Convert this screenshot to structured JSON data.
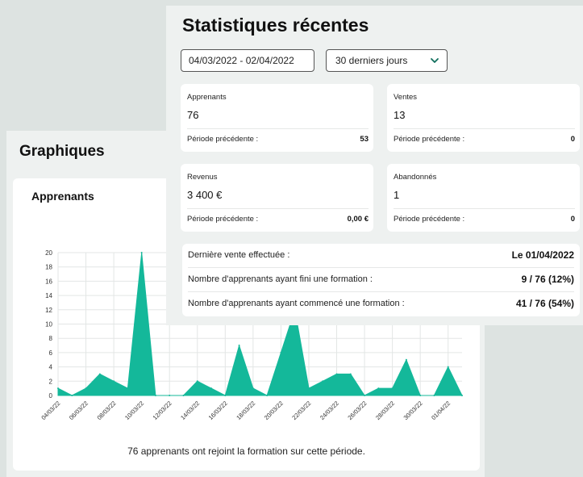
{
  "graph_panel": {
    "title": "Graphiques",
    "card_title": "Apprenants",
    "caption": "76 apprenants ont rejoint la formation sur cette période."
  },
  "chart_data": {
    "type": "area",
    "title": "",
    "xlabel": "",
    "ylabel": "",
    "ylim": [
      0,
      20
    ],
    "yticks": [
      0,
      2,
      4,
      6,
      8,
      10,
      12,
      14,
      16,
      18,
      20
    ],
    "grid": true,
    "color": "#14b89a",
    "x": [
      "04/03/22",
      "05/03/22",
      "06/03/22",
      "07/03/22",
      "08/03/22",
      "09/03/22",
      "10/03/22",
      "11/03/22",
      "12/03/22",
      "13/03/22",
      "14/03/22",
      "15/03/22",
      "16/03/22",
      "17/03/22",
      "18/03/22",
      "19/03/22",
      "20/03/22",
      "21/03/22",
      "22/03/22",
      "23/03/22",
      "24/03/22",
      "25/03/22",
      "26/03/22",
      "27/03/22",
      "28/03/22",
      "29/03/22",
      "30/03/22",
      "31/03/22",
      "01/04/22",
      "02/04/22"
    ],
    "xtick_labels": [
      "04/03/22",
      "06/03/22",
      "08/03/22",
      "10/03/22",
      "12/03/22",
      "14/03/22",
      "16/03/22",
      "18/03/22",
      "20/03/22",
      "22/03/22",
      "24/03/22",
      "26/03/22",
      "28/03/22",
      "30/03/22",
      "01/04/22"
    ],
    "values": [
      1,
      0,
      1,
      3,
      2,
      1,
      20,
      0,
      0,
      0,
      2,
      1,
      0,
      7,
      1,
      0,
      6,
      12,
      1,
      2,
      3,
      3,
      0,
      1,
      1,
      5,
      0,
      0,
      4,
      0
    ]
  },
  "stats_panel": {
    "title": "Statistiques récentes",
    "date_range": "04/03/2022 - 02/04/2022",
    "period_select": "30 derniers jours",
    "cards": [
      {
        "label": "Apprenants",
        "value": "76",
        "prev_label": "Période précédente :",
        "prev_value": "53"
      },
      {
        "label": "Ventes",
        "value": "13",
        "prev_label": "Période précédente :",
        "prev_value": "0"
      },
      {
        "label": "Revenus",
        "value": "3 400 €",
        "prev_label": "Période précédente :",
        "prev_value": "0,00 €"
      },
      {
        "label": "Abandonnés",
        "value": "1",
        "prev_label": "Période précédente :",
        "prev_value": "0"
      }
    ],
    "summary": [
      {
        "label": "Dernière vente effectuée :",
        "value": "Le 01/04/2022"
      },
      {
        "label": "Nombre d'apprenants ayant fini une formation :",
        "value": "9 / 76 (12%)"
      },
      {
        "label": "Nombre d'apprenants ayant commencé une formation :",
        "value": "41 / 76 (54%)"
      }
    ]
  },
  "icons": {
    "select_chevron": "chevron-down-icon"
  },
  "colors": {
    "accent": "#14b89a",
    "chevron": "#0f6e5c"
  }
}
